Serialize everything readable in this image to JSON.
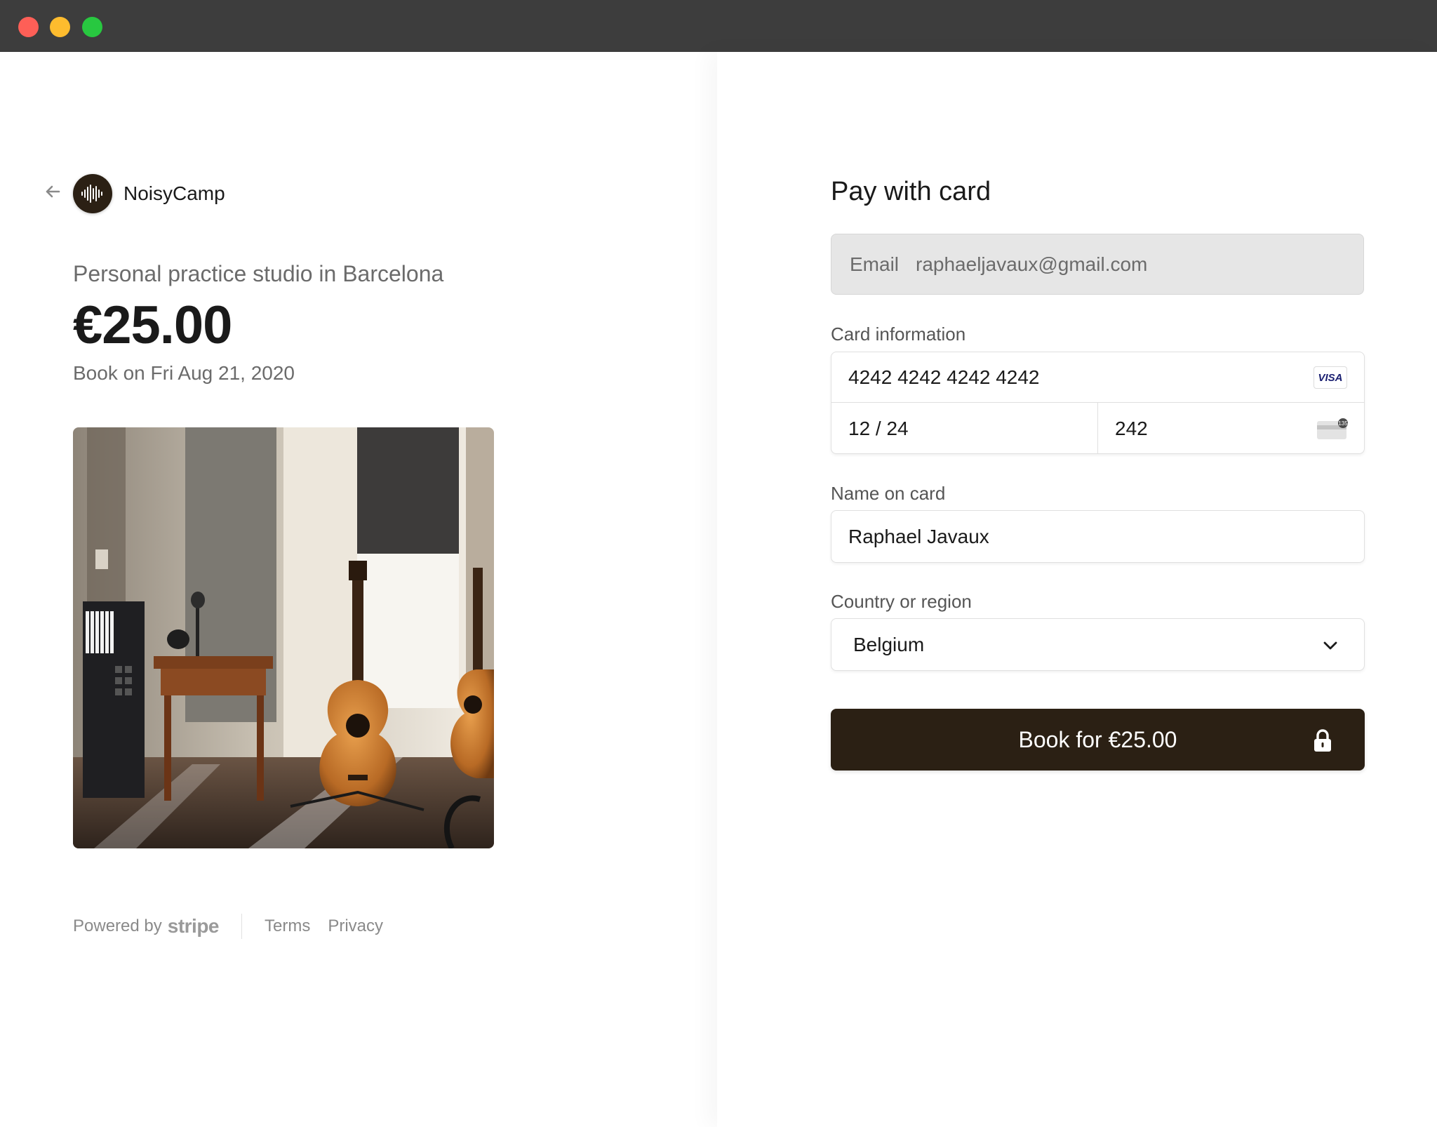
{
  "window": {
    "controls": [
      "close",
      "minimize",
      "maximize"
    ]
  },
  "merchant": {
    "name": "NoisyCamp",
    "logo_icon": "soundwave-icon",
    "back_icon": "arrow-left-icon"
  },
  "product": {
    "name": "Personal practice studio in Barcelona",
    "price": "€25.00",
    "date_line": "Book on Fri Aug 21, 2020",
    "image": "studio-photo"
  },
  "footer": {
    "powered_by": "Powered by",
    "stripe": "stripe",
    "terms": "Terms",
    "privacy": "Privacy"
  },
  "form": {
    "title": "Pay with card",
    "email": {
      "label": "Email",
      "value": "raphaeljavaux@gmail.com"
    },
    "card": {
      "label": "Card information",
      "number": "4242 4242 4242 4242",
      "brand": "VISA",
      "expiry": "12 / 24",
      "cvc": "242",
      "cvc_icon_text": "135"
    },
    "name": {
      "label": "Name on card",
      "value": "Raphael Javaux"
    },
    "country": {
      "label": "Country or region",
      "value": "Belgium"
    },
    "submit": {
      "label": "Book for €25.00",
      "icon": "lock-icon"
    }
  },
  "colors": {
    "brand": "#2b2014",
    "muted_text": "#6b6b6b",
    "email_bg": "#e6e6e6"
  }
}
